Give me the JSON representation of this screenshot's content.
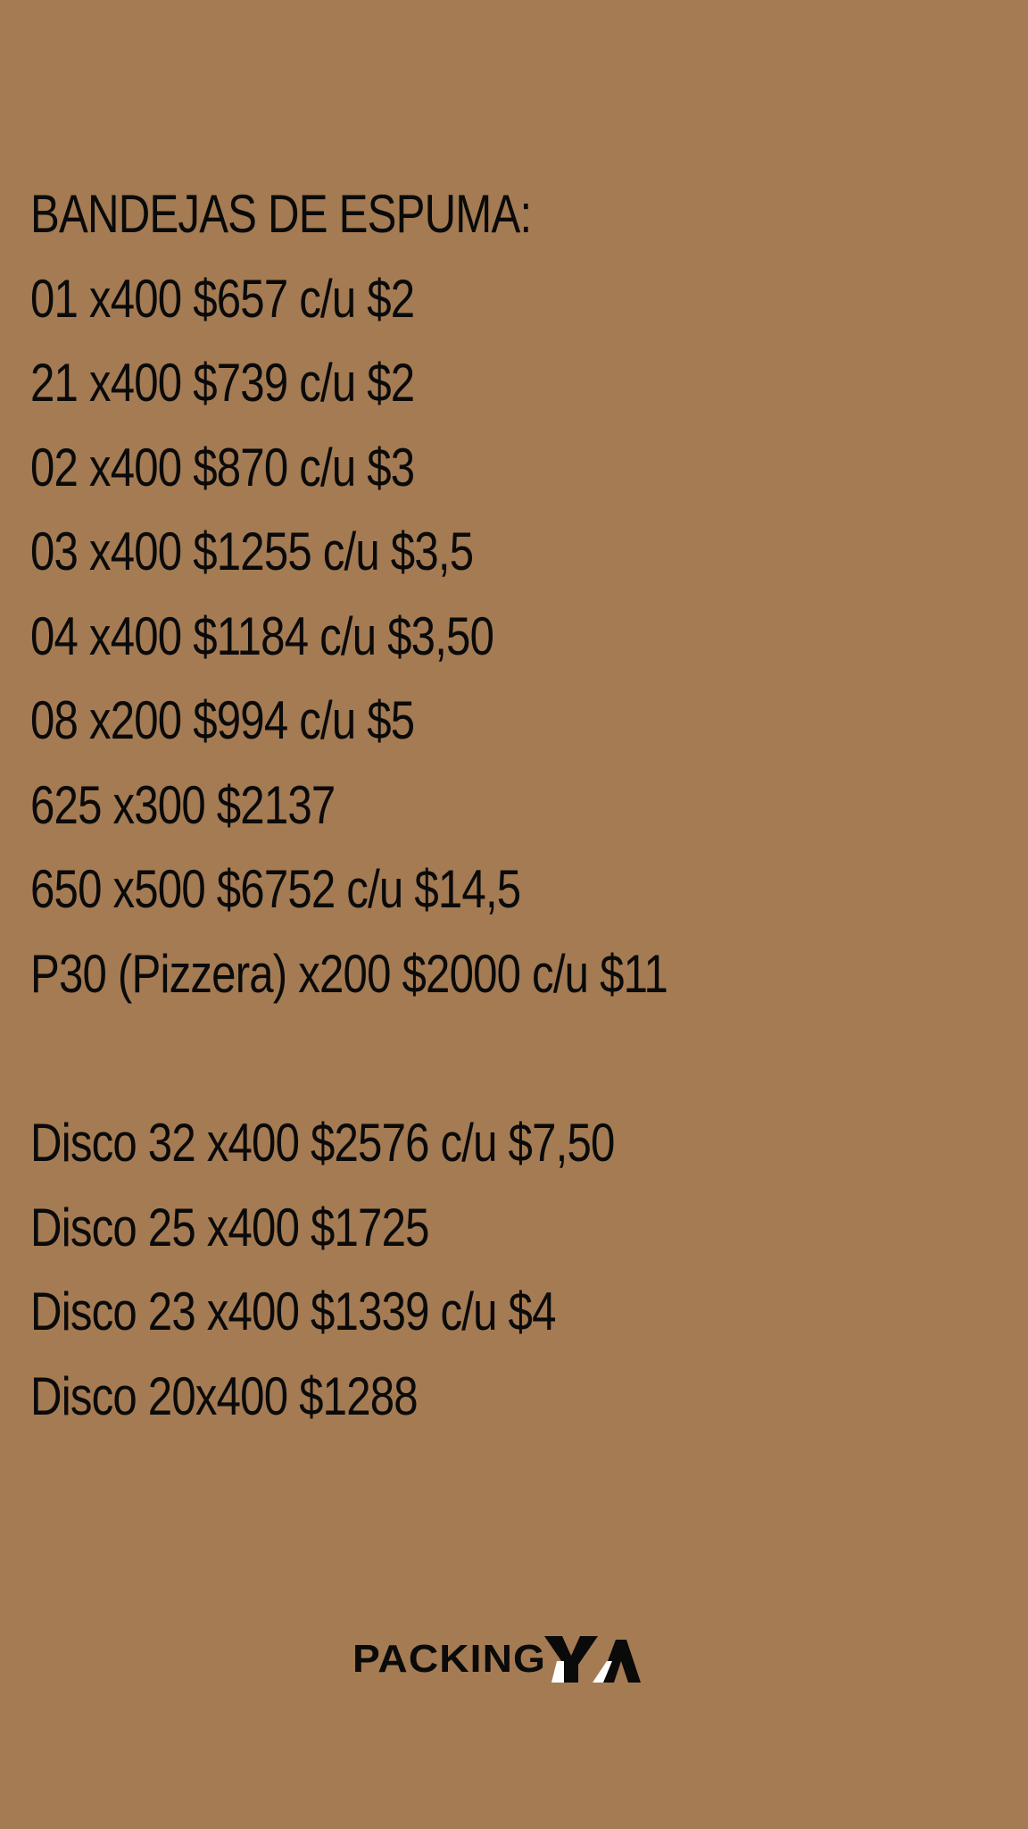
{
  "title": "BANDEJAS DE ESPUMA:",
  "trays": [
    "01 x400 $657 c/u $2",
    "21 x400 $739 c/u $2",
    "02 x400 $870 c/u $3",
    "03 x400 $1255 c/u $3,5",
    "04 x400 $1184 c/u $3,50",
    "08 x200 $994 c/u $5",
    "625 x300 $2137",
    "650 x500 $6752 c/u $14,5",
    "P30 (Pizzera) x200 $2000 c/u $11"
  ],
  "discs": [
    "Disco 32 x400 $2576 c/u $7,50",
    "Disco 25 x400 $1725",
    "Disco 23 x400 $1339 c/u $4",
    "Disco 20x400 $1288"
  ],
  "logo": {
    "text": "PACKING",
    "mark": "YA"
  },
  "colors": {
    "background": "#a47b53",
    "text": "#0a0a0a",
    "logo_accent": "#ffffff"
  }
}
